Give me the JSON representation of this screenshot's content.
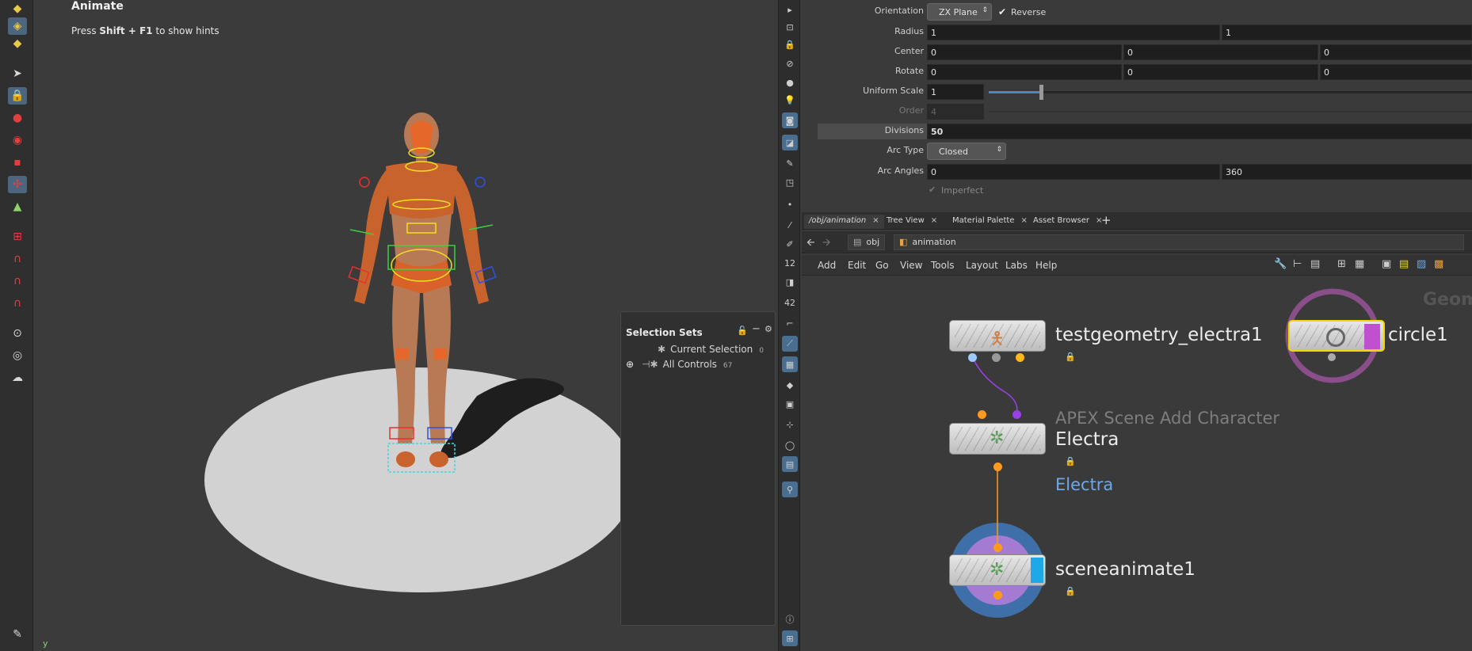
{
  "viewport": {
    "title": "Animate",
    "hint_prefix": "Press ",
    "hint_keys": "Shift + F1",
    "hint_suffix": " to show hints",
    "axis_label": "y"
  },
  "selection_sets": {
    "title": "Selection Sets",
    "items": [
      {
        "label": "Current Selection",
        "count": "0"
      },
      {
        "label": "All Controls",
        "count": "67"
      }
    ]
  },
  "params": {
    "orientation": {
      "label": "Orientation",
      "value": "ZX Plane",
      "reverse_label": "Reverse"
    },
    "radius": {
      "label": "Radius",
      "values": [
        "1",
        "1"
      ]
    },
    "center": {
      "label": "Center",
      "values": [
        "0",
        "0",
        "0"
      ]
    },
    "rotate": {
      "label": "Rotate",
      "values": [
        "0",
        "0",
        "0"
      ]
    },
    "uniform_scale": {
      "label": "Uniform Scale",
      "value": "1",
      "slider_fraction": 0.12
    },
    "order": {
      "label": "Order",
      "value": "4"
    },
    "divisions": {
      "label": "Divisions",
      "value": "50"
    },
    "arc_type": {
      "label": "Arc Type",
      "value": "Closed"
    },
    "arc_angles": {
      "label": "Arc Angles",
      "values": [
        "0",
        "360"
      ]
    },
    "imperfect": {
      "label": "Imperfect"
    }
  },
  "network": {
    "tabs": [
      "/obj/animation",
      "Tree View",
      "Material Palette",
      "Asset Browser"
    ],
    "path": {
      "root": "obj",
      "current": "animation"
    },
    "menu": [
      "Add",
      "Edit",
      "Go",
      "View",
      "Tools",
      "Layout",
      "Labs",
      "Help"
    ],
    "corner_label": "Geom",
    "nodes": {
      "testgeometry": "testgeometry_electra1",
      "circle": "circle1",
      "apex_type": "APEX Scene Add Character",
      "apex_name": "Electra",
      "apex_sub": "Electra",
      "sceneanimate": "sceneanimate1"
    }
  },
  "colors": {
    "accent": "#4d6680",
    "orange": "#ff9a1f",
    "purple": "#9a40e6",
    "node_blue": "#6fa8e6"
  }
}
